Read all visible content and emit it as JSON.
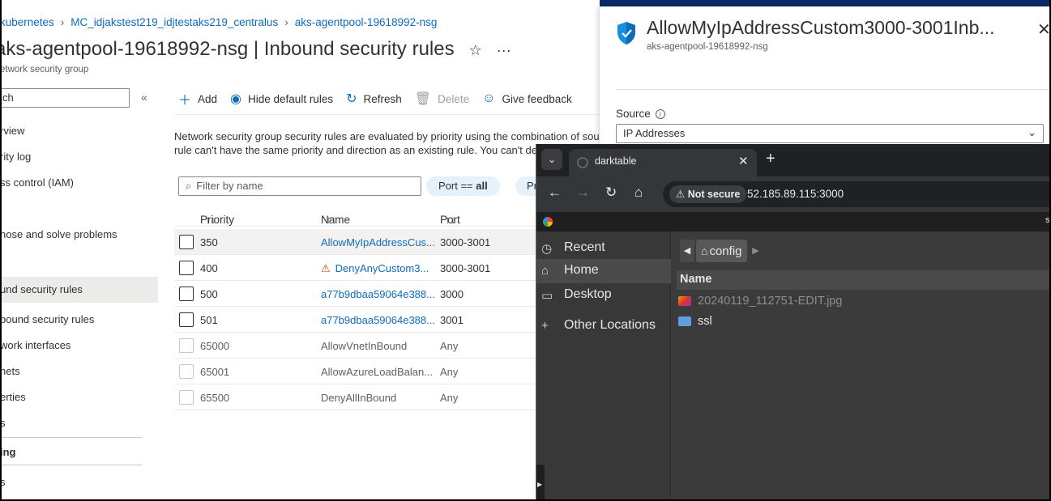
{
  "breadcrumb": [
    "kubernetes",
    "MC_idjakstest219_idjtestaks219_centralus",
    "aks-agentpool-19618992-nsg"
  ],
  "page": {
    "title": "aks-agentpool-19618992-nsg | Inbound security rules",
    "subtitle": "etwork security group"
  },
  "sidebar": {
    "search_value": "ch",
    "collapse_glyph": "«",
    "items": [
      "rview",
      "rity log",
      "ss control (IAM)",
      "",
      "nose and solve problems",
      "und security rules",
      "bound security rules",
      "work interfaces",
      "nets",
      "erties",
      "s"
    ],
    "section_label": "ing",
    "last_item": "s"
  },
  "toolbar": {
    "add": "Add",
    "hide_default": "Hide default rules",
    "refresh": "Refresh",
    "delete": "Delete",
    "feedback": "Give feedback"
  },
  "description": {
    "line1": "Network security group security rules are evaluated by priority using the combination of sou",
    "line2": "rule can't have the same priority and direction as an existing rule. You can't de"
  },
  "filter": {
    "placeholder": "Filter by name",
    "pill_port_prefix": "Port == ",
    "pill_port_value": "all",
    "pill_next": "Pr"
  },
  "table": {
    "columns": [
      "Priority",
      "Name",
      "Port"
    ],
    "rows": [
      {
        "priority": "350",
        "name": "AllowMyIpAddressCus...",
        "port": "3000-3001"
      },
      {
        "priority": "400",
        "name": "DenyAnyCustom3...",
        "port": "3000-3001"
      },
      {
        "priority": "500",
        "name": "a77b9dbaa59064e388...",
        "port": "3000"
      },
      {
        "priority": "501",
        "name": "a77b9dbaa59064e388...",
        "port": "3001"
      },
      {
        "priority": "65000",
        "name": "AllowVnetInBound",
        "port": "Any"
      },
      {
        "priority": "65001",
        "name": "AllowAzureLoadBalan...",
        "port": "Any"
      },
      {
        "priority": "65500",
        "name": "DenyAllInBound",
        "port": "Any"
      }
    ]
  },
  "panel": {
    "title": "AllowMyIpAddressCustom3000-3001Inb...",
    "subtitle": "aks-agentpool-19618992-nsg",
    "source_label": "Source",
    "source_value": "IP Addresses"
  },
  "browser": {
    "tab_title": "darktable",
    "security_label": "Not secure",
    "url": "52.185.89.115:3000",
    "bookmark_text": "s"
  },
  "file_chooser": {
    "places": [
      "Recent",
      "Home",
      "Desktop",
      "Other Locations"
    ],
    "path": "config",
    "column_name": "Name",
    "files": [
      {
        "name": "20240119_112751-EDIT.jpg",
        "type": "image"
      },
      {
        "name": "ssl",
        "type": "folder"
      }
    ]
  },
  "colors": {
    "azure_link": "#0f6cbd",
    "chrome_bg": "#202124",
    "gtk_bg": "#3b3b3b"
  }
}
